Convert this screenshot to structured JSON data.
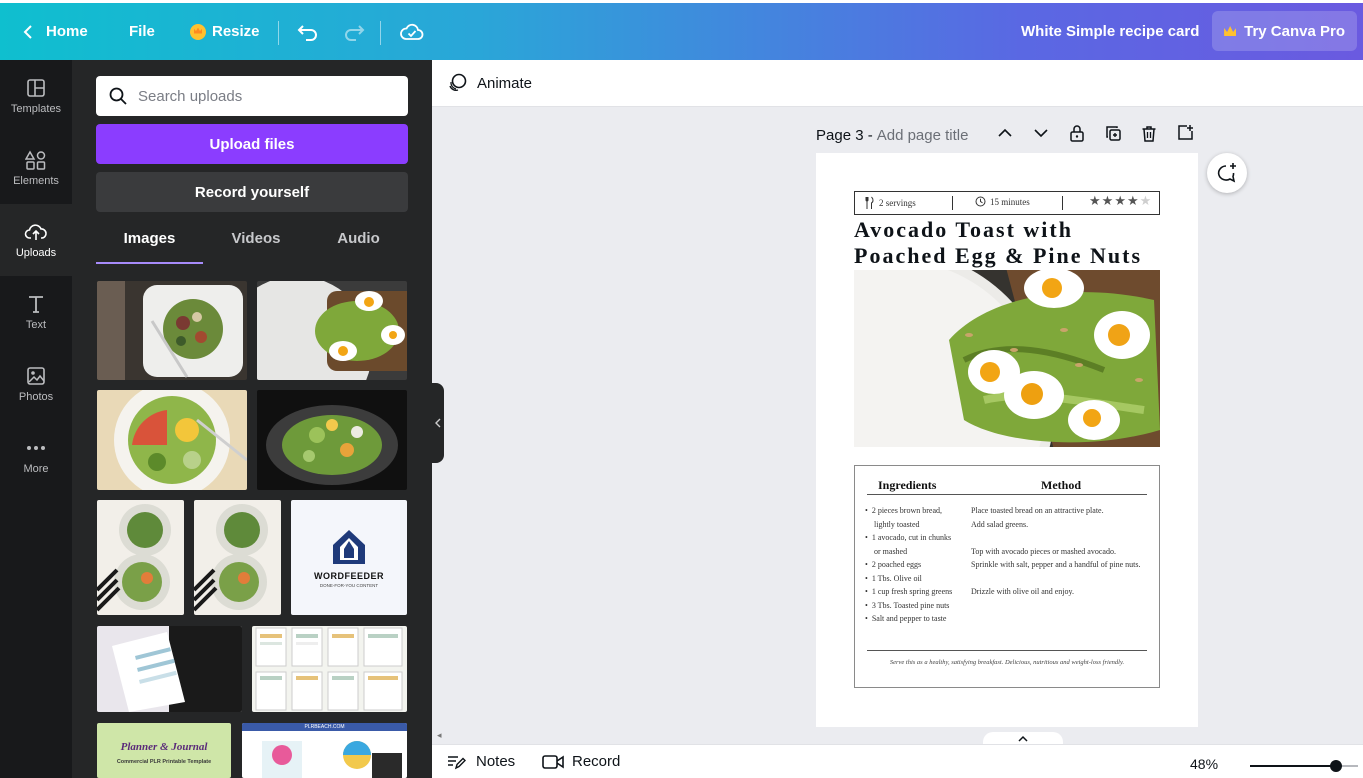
{
  "topbar": {
    "home_label": "Home",
    "file_label": "File",
    "resize_label": "Resize",
    "doc_title": "White Simple recipe card",
    "try_pro_label": "Try Canva Pro"
  },
  "rail": {
    "items": [
      {
        "label": "Templates",
        "icon": "templates-icon"
      },
      {
        "label": "Elements",
        "icon": "elements-icon"
      },
      {
        "label": "Uploads",
        "icon": "upload-cloud-icon"
      },
      {
        "label": "Text",
        "icon": "text-icon"
      },
      {
        "label": "Photos",
        "icon": "photos-icon"
      },
      {
        "label": "More",
        "icon": "more-dots-icon"
      }
    ]
  },
  "panel": {
    "search_placeholder": "Search uploads",
    "upload_label": "Upload files",
    "record_label": "Record yourself",
    "tabs": [
      {
        "label": "Images",
        "active": true
      },
      {
        "label": "Videos",
        "active": false
      },
      {
        "label": "Audio",
        "active": false
      }
    ],
    "thumb_text": {
      "wordfeeder_brand": "WORDFEEDER",
      "wordfeeder_tagline": "DONE-FOR-YOU CONTENT",
      "planner_line1": "Planner & Journal",
      "planner_line2": "Commercial PLR Printable Template",
      "site": "PLRBEACH.COM"
    }
  },
  "editor": {
    "animate_label": "Animate",
    "page_label": "Page 3 -",
    "page_title_placeholder": "Add page title"
  },
  "recipe": {
    "servings": "2 servings",
    "time": "15 minutes",
    "rating": 4,
    "rating_max": 5,
    "title_line1": "Avocado Toast with",
    "title_line2": "Poached Egg & Pine Nuts",
    "ingredients_heading": "Ingredients",
    "method_heading": "Method",
    "ingredients": [
      [
        "2 pieces brown bread,",
        "lightly toasted"
      ],
      [
        "1 avocado, cut in chunks",
        "or mashed"
      ],
      [
        "2 poached eggs"
      ],
      [
        "1 Tbs. Olive oil"
      ],
      [
        "1 cup fresh spring greens"
      ],
      [
        "3 Tbs. Toasted pine nuts"
      ],
      [
        "Salt and pepper to taste"
      ]
    ],
    "method": [
      [
        "Place toasted bread on an attractive plate.",
        "Add salad greens."
      ],
      [
        "Top with avocado pieces or mashed avocado.",
        "Sprinkle with salt, pepper and a handful of pine nuts."
      ],
      [
        "Drizzle with olive oil and enjoy."
      ]
    ],
    "footer": "Serve this as a healthy, satisfying breakfast. Delicious, nutritious and weight-loss friendly."
  },
  "bottombar": {
    "notes_label": "Notes",
    "record_label": "Record",
    "zoom": "48%",
    "zoom_fraction": 0.8
  }
}
